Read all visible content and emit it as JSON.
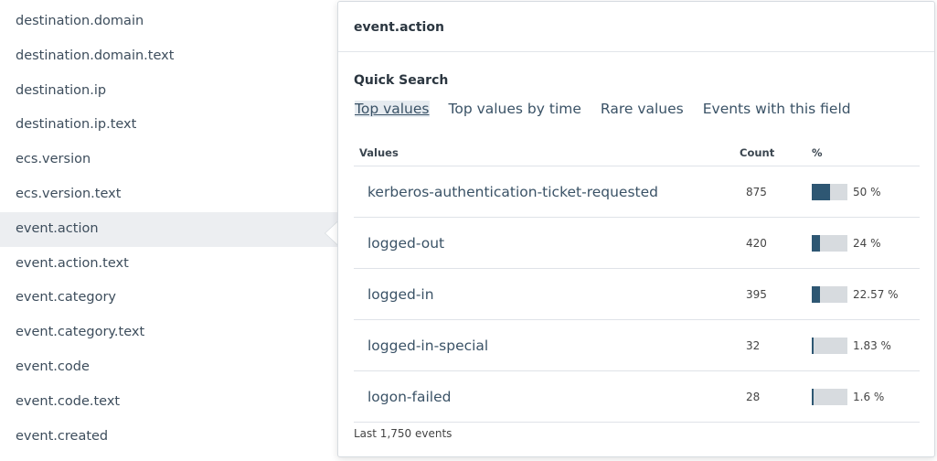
{
  "field_list": [
    "destination.domain",
    "destination.domain.text",
    "destination.ip",
    "destination.ip.text",
    "ecs.version",
    "ecs.version.text",
    "event.action",
    "event.action.text",
    "event.category",
    "event.category.text",
    "event.code",
    "event.code.text",
    "event.created"
  ],
  "active_field_index": 6,
  "popover": {
    "title": "event.action",
    "quick_search_label": "Quick Search",
    "tabs": [
      "Top values",
      "Top values by time",
      "Rare values",
      "Events with this field"
    ],
    "active_tab": 0,
    "table": {
      "headers": {
        "values": "Values",
        "count": "Count",
        "percent": "%"
      },
      "rows": [
        {
          "value": "kerberos-authentication-ticket-requested",
          "count": "875",
          "percent_label": "50 %",
          "percent": 50
        },
        {
          "value": "logged-out",
          "count": "420",
          "percent_label": "24 %",
          "percent": 24
        },
        {
          "value": "logged-in",
          "count": "395",
          "percent_label": "22.57 %",
          "percent": 22.57
        },
        {
          "value": "logged-in-special",
          "count": "32",
          "percent_label": "1.83 %",
          "percent": 1.83
        },
        {
          "value": "logon-failed",
          "count": "28",
          "percent_label": "1.6 %",
          "percent": 1.6
        }
      ]
    },
    "footer": "Last 1,750 events"
  },
  "colors": {
    "bar_fill": "#2e5773",
    "bar_track": "#d7dbdf",
    "link_text": "#3a5266"
  }
}
